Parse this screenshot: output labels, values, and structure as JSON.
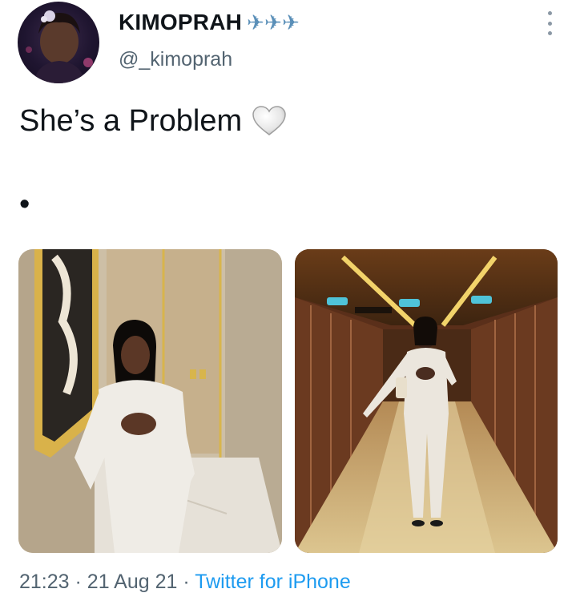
{
  "author": {
    "display_name": "KIMOPRAH",
    "badges": [
      "airplane-icon",
      "airplane-icon",
      "airplane-icon"
    ],
    "badge_glyph": "✈",
    "handle": "@_kimoprah"
  },
  "tweet": {
    "text": "She’s a Problem",
    "emoji": "white-heart-icon",
    "bullet": "•"
  },
  "media": [
    {
      "name": "photo-left"
    },
    {
      "name": "photo-right"
    }
  ],
  "meta": {
    "time": "21:23",
    "separator": "·",
    "date": "21 Aug 21",
    "source": "Twitter for iPhone"
  },
  "colors": {
    "text": "#0f1419",
    "secondary": "#536471",
    "link": "#1d9bf0",
    "badge": "#5a8fb8"
  }
}
